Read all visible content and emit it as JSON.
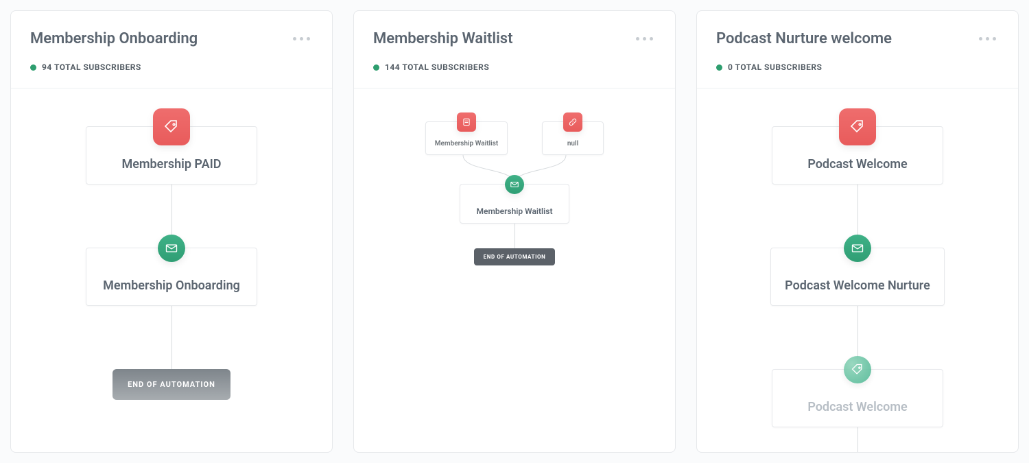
{
  "cards": [
    {
      "title": "Membership Onboarding",
      "subscribers_text": "94 TOTAL SUBSCRIBERS",
      "step1": "Membership PAID",
      "step2": "Membership Onboarding",
      "end": "END OF AUTOMATION"
    },
    {
      "title": "Membership Waitlist",
      "subscribers_text": "144 TOTAL SUBSCRIBERS",
      "branch_left": "Membership Waitlist",
      "branch_right": "null",
      "merged": "Membership Waitlist",
      "end": "END OF AUTOMATION"
    },
    {
      "title": "Podcast Nurture welcome",
      "subscribers_text": "0 TOTAL SUBSCRIBERS",
      "step1": "Podcast Welcome",
      "step2": "Podcast Welcome Nurture",
      "step3": "Podcast Welcome"
    }
  ],
  "colors": {
    "red": "#e85b5b",
    "green": "#2f9e74",
    "gray": "#7e858b"
  }
}
